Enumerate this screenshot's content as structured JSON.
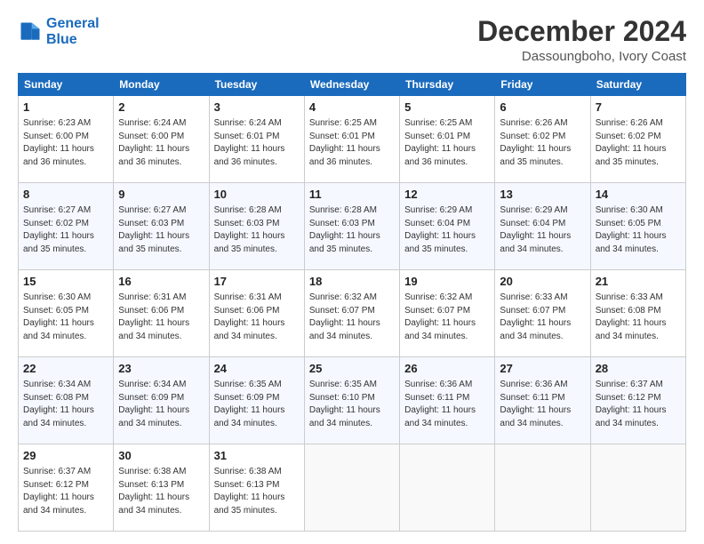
{
  "logo": {
    "line1": "General",
    "line2": "Blue"
  },
  "header": {
    "month_year": "December 2024",
    "location": "Dassoungboho, Ivory Coast"
  },
  "weekdays": [
    "Sunday",
    "Monday",
    "Tuesday",
    "Wednesday",
    "Thursday",
    "Friday",
    "Saturday"
  ],
  "weeks": [
    [
      {
        "day": "1",
        "info": "Sunrise: 6:23 AM\nSunset: 6:00 PM\nDaylight: 11 hours\nand 36 minutes."
      },
      {
        "day": "2",
        "info": "Sunrise: 6:24 AM\nSunset: 6:00 PM\nDaylight: 11 hours\nand 36 minutes."
      },
      {
        "day": "3",
        "info": "Sunrise: 6:24 AM\nSunset: 6:01 PM\nDaylight: 11 hours\nand 36 minutes."
      },
      {
        "day": "4",
        "info": "Sunrise: 6:25 AM\nSunset: 6:01 PM\nDaylight: 11 hours\nand 36 minutes."
      },
      {
        "day": "5",
        "info": "Sunrise: 6:25 AM\nSunset: 6:01 PM\nDaylight: 11 hours\nand 36 minutes."
      },
      {
        "day": "6",
        "info": "Sunrise: 6:26 AM\nSunset: 6:02 PM\nDaylight: 11 hours\nand 35 minutes."
      },
      {
        "day": "7",
        "info": "Sunrise: 6:26 AM\nSunset: 6:02 PM\nDaylight: 11 hours\nand 35 minutes."
      }
    ],
    [
      {
        "day": "8",
        "info": "Sunrise: 6:27 AM\nSunset: 6:02 PM\nDaylight: 11 hours\nand 35 minutes."
      },
      {
        "day": "9",
        "info": "Sunrise: 6:27 AM\nSunset: 6:03 PM\nDaylight: 11 hours\nand 35 minutes."
      },
      {
        "day": "10",
        "info": "Sunrise: 6:28 AM\nSunset: 6:03 PM\nDaylight: 11 hours\nand 35 minutes."
      },
      {
        "day": "11",
        "info": "Sunrise: 6:28 AM\nSunset: 6:03 PM\nDaylight: 11 hours\nand 35 minutes."
      },
      {
        "day": "12",
        "info": "Sunrise: 6:29 AM\nSunset: 6:04 PM\nDaylight: 11 hours\nand 35 minutes."
      },
      {
        "day": "13",
        "info": "Sunrise: 6:29 AM\nSunset: 6:04 PM\nDaylight: 11 hours\nand 34 minutes."
      },
      {
        "day": "14",
        "info": "Sunrise: 6:30 AM\nSunset: 6:05 PM\nDaylight: 11 hours\nand 34 minutes."
      }
    ],
    [
      {
        "day": "15",
        "info": "Sunrise: 6:30 AM\nSunset: 6:05 PM\nDaylight: 11 hours\nand 34 minutes."
      },
      {
        "day": "16",
        "info": "Sunrise: 6:31 AM\nSunset: 6:06 PM\nDaylight: 11 hours\nand 34 minutes."
      },
      {
        "day": "17",
        "info": "Sunrise: 6:31 AM\nSunset: 6:06 PM\nDaylight: 11 hours\nand 34 minutes."
      },
      {
        "day": "18",
        "info": "Sunrise: 6:32 AM\nSunset: 6:07 PM\nDaylight: 11 hours\nand 34 minutes."
      },
      {
        "day": "19",
        "info": "Sunrise: 6:32 AM\nSunset: 6:07 PM\nDaylight: 11 hours\nand 34 minutes."
      },
      {
        "day": "20",
        "info": "Sunrise: 6:33 AM\nSunset: 6:07 PM\nDaylight: 11 hours\nand 34 minutes."
      },
      {
        "day": "21",
        "info": "Sunrise: 6:33 AM\nSunset: 6:08 PM\nDaylight: 11 hours\nand 34 minutes."
      }
    ],
    [
      {
        "day": "22",
        "info": "Sunrise: 6:34 AM\nSunset: 6:08 PM\nDaylight: 11 hours\nand 34 minutes."
      },
      {
        "day": "23",
        "info": "Sunrise: 6:34 AM\nSunset: 6:09 PM\nDaylight: 11 hours\nand 34 minutes."
      },
      {
        "day": "24",
        "info": "Sunrise: 6:35 AM\nSunset: 6:09 PM\nDaylight: 11 hours\nand 34 minutes."
      },
      {
        "day": "25",
        "info": "Sunrise: 6:35 AM\nSunset: 6:10 PM\nDaylight: 11 hours\nand 34 minutes."
      },
      {
        "day": "26",
        "info": "Sunrise: 6:36 AM\nSunset: 6:11 PM\nDaylight: 11 hours\nand 34 minutes."
      },
      {
        "day": "27",
        "info": "Sunrise: 6:36 AM\nSunset: 6:11 PM\nDaylight: 11 hours\nand 34 minutes."
      },
      {
        "day": "28",
        "info": "Sunrise: 6:37 AM\nSunset: 6:12 PM\nDaylight: 11 hours\nand 34 minutes."
      }
    ],
    [
      {
        "day": "29",
        "info": "Sunrise: 6:37 AM\nSunset: 6:12 PM\nDaylight: 11 hours\nand 34 minutes."
      },
      {
        "day": "30",
        "info": "Sunrise: 6:38 AM\nSunset: 6:13 PM\nDaylight: 11 hours\nand 34 minutes."
      },
      {
        "day": "31",
        "info": "Sunrise: 6:38 AM\nSunset: 6:13 PM\nDaylight: 11 hours\nand 35 minutes."
      },
      {
        "day": "",
        "info": ""
      },
      {
        "day": "",
        "info": ""
      },
      {
        "day": "",
        "info": ""
      },
      {
        "day": "",
        "info": ""
      }
    ]
  ]
}
